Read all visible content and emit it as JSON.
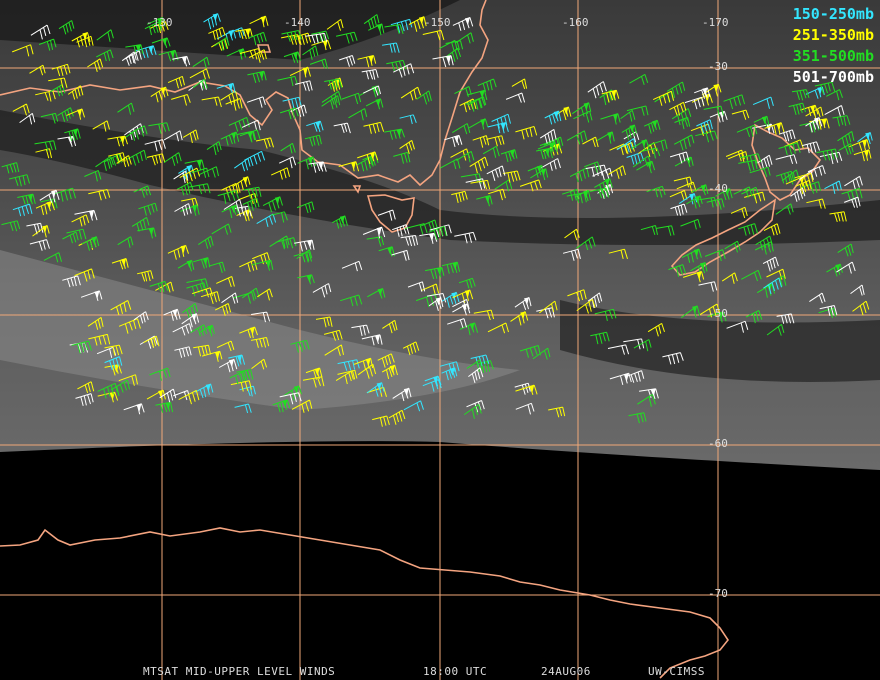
{
  "title": "MTSAT MID-UPPER LEVEL WINDS",
  "time": "18:00 UTC",
  "date": "24AUG06",
  "source": "UW-CIMSS",
  "longitude_labels": [
    "-130",
    "-140",
    "-150",
    "-160",
    "-170"
  ],
  "latitude_labels": [
    "-30",
    "-40",
    "-50",
    "-60",
    "-70"
  ],
  "legend": [
    {
      "label": "150-250mb",
      "color": "#33e6ff"
    },
    {
      "label": "251-350mb",
      "color": "#ffff00"
    },
    {
      "label": "351-500mb",
      "color": "#22dd22"
    },
    {
      "label": "501-700mb",
      "color": "#ffffff"
    }
  ],
  "colors": {
    "grid": "#f0a878",
    "coastline": "#f4a480",
    "background": "#000000"
  }
}
